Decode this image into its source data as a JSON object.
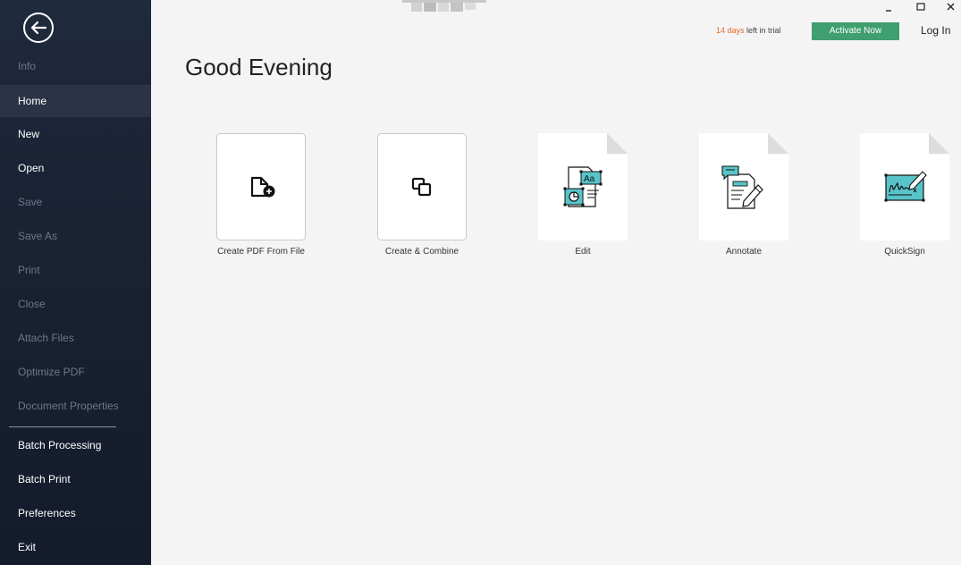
{
  "sidebar": {
    "items": [
      {
        "label": "Info",
        "state": "disabled"
      },
      {
        "label": "Home",
        "state": "selected"
      },
      {
        "label": "New",
        "state": "enabled"
      },
      {
        "label": "Open",
        "state": "enabled"
      },
      {
        "label": "Save",
        "state": "disabled"
      },
      {
        "label": "Save As",
        "state": "disabled"
      },
      {
        "label": "Print",
        "state": "disabled"
      },
      {
        "label": "Close",
        "state": "disabled"
      },
      {
        "label": "Attach Files",
        "state": "disabled"
      },
      {
        "label": "Optimize PDF",
        "state": "disabled"
      },
      {
        "label": "Document Properties",
        "state": "disabled"
      },
      {
        "label": "Batch Processing",
        "state": "enabled"
      },
      {
        "label": "Batch Print",
        "state": "enabled"
      },
      {
        "label": "Preferences",
        "state": "enabled"
      },
      {
        "label": "Exit",
        "state": "enabled"
      }
    ]
  },
  "header": {
    "trial_days": "14 days",
    "trial_rest": " left in trial",
    "activate_label": "Activate Now",
    "login_label": "Log In"
  },
  "window_controls": {
    "minimize": "–",
    "maximize": "☐",
    "close": "✕"
  },
  "main": {
    "greeting": "Good Evening",
    "tiles": [
      {
        "label": "Create PDF From File",
        "icon": "file-add-icon"
      },
      {
        "label": "Create & Combine",
        "icon": "combine-icon"
      },
      {
        "label": "Edit",
        "icon": "edit-document-icon"
      },
      {
        "label": "Annotate",
        "icon": "annotate-icon"
      },
      {
        "label": "QuickSign",
        "icon": "signature-icon"
      }
    ]
  },
  "colors": {
    "sidebar_bg": "#1a2234",
    "accent_green": "#3f9f6e",
    "trial_orange": "#e46c2d",
    "icon_teal": "#58c4c9"
  }
}
